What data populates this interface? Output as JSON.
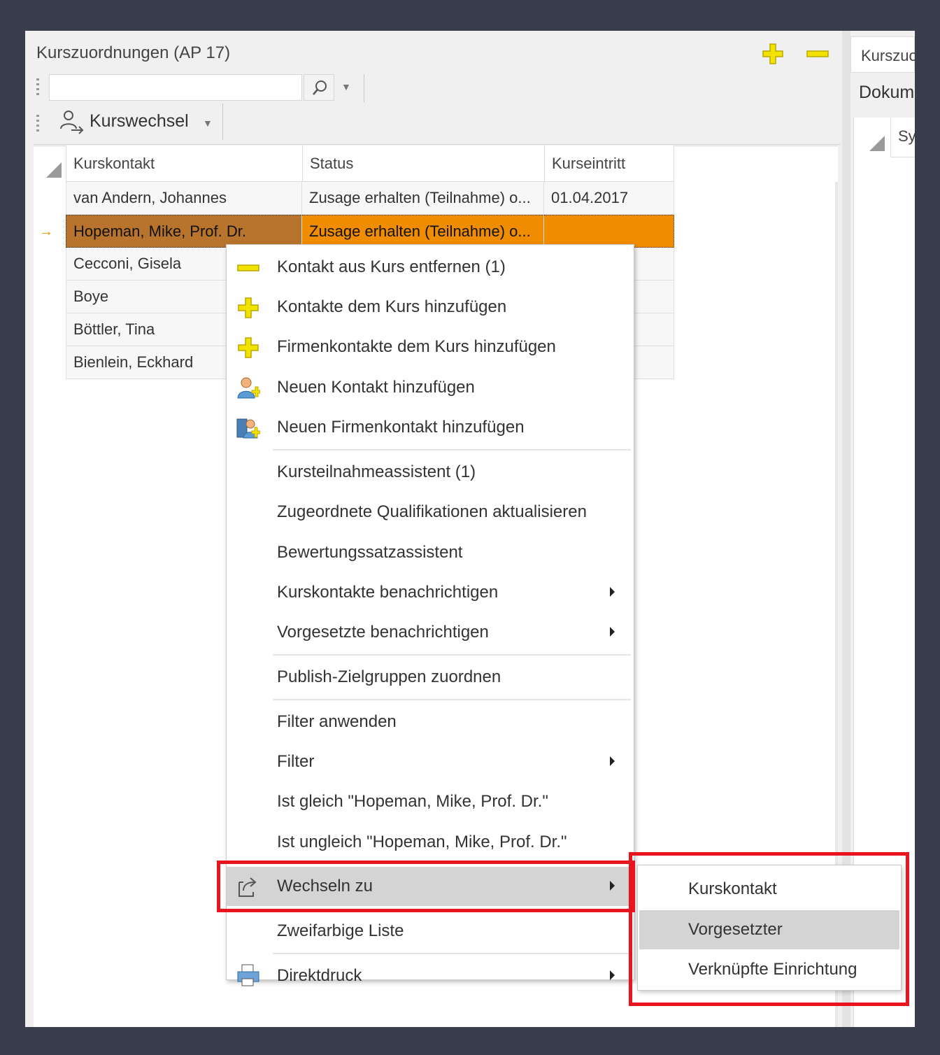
{
  "panel": {
    "title": "Kurszuordnungen (AP 17)",
    "search_value": "",
    "kurswechsel_label": "Kurswechsel"
  },
  "grid": {
    "columns": [
      "Kurskontakt",
      "Status",
      "Kurseintritt"
    ],
    "rows": [
      {
        "kontakt": "van Andern, Johannes",
        "status": "Zusage erhalten (Teilnahme) o...",
        "eintritt": "01.04.2017"
      },
      {
        "kontakt": "Hopeman, Mike, Prof. Dr.",
        "status": "Zusage erhalten (Teilnahme) o...",
        "eintritt": "",
        "selected": true
      },
      {
        "kontakt": "Cecconi, Gisela",
        "status": "",
        "eintritt": ""
      },
      {
        "kontakt": "Boye",
        "status": "",
        "eintritt": ""
      },
      {
        "kontakt": "Böttler, Tina",
        "status": "",
        "eintritt": ""
      },
      {
        "kontakt": "Bienlein, Eckhard",
        "status": "",
        "eintritt": ""
      }
    ],
    "current_row_indicator": "→"
  },
  "right_panel": {
    "tab_label": "Kurszuo",
    "section_label": "Dokum",
    "column_label": "Sy"
  },
  "context_menu": {
    "items": [
      {
        "label": "Kontakt aus Kurs entfernen (1)",
        "icon": "minus-icon"
      },
      {
        "label": "Kontakte dem Kurs hinzufügen",
        "icon": "plus-icon"
      },
      {
        "label": "Firmenkontakte dem Kurs hinzufügen",
        "icon": "plus-icon"
      },
      {
        "label": "Neuen Kontakt hinzufügen",
        "icon": "new-contact-icon"
      },
      {
        "label": "Neuen Firmenkontakt hinzufügen",
        "icon": "new-company-contact-icon"
      },
      {
        "label": "Kursteilnahmeassistent (1)"
      },
      {
        "label": "Zugeordnete Qualifikationen aktualisieren"
      },
      {
        "label": "Bewertungssatzassistent"
      },
      {
        "label": "Kurskontakte benachrichtigen",
        "submenu": true
      },
      {
        "label": "Vorgesetzte benachrichtigen",
        "submenu": true
      },
      {
        "label": "Publish-Zielgruppen zuordnen"
      },
      {
        "label": "Filter anwenden"
      },
      {
        "label": "Filter",
        "submenu": true
      },
      {
        "label": "Ist gleich \"Hopeman, Mike, Prof. Dr.\""
      },
      {
        "label": "Ist ungleich \"Hopeman, Mike, Prof. Dr.\""
      },
      {
        "label": "Wechseln zu",
        "icon": "switch-to-icon",
        "submenu": true,
        "highlighted": true
      },
      {
        "label": "Zweifarbige Liste"
      },
      {
        "label": "Direktdruck",
        "icon": "print-icon",
        "submenu": true
      }
    ]
  },
  "submenu": {
    "items": [
      {
        "label": "Kurskontakt"
      },
      {
        "label": "Vorgesetzter",
        "highlighted": true
      },
      {
        "label": "Verknüpfte Einrichtung"
      }
    ]
  },
  "colors": {
    "selection": "#f08c00",
    "selection_first_cell": "#b8742c",
    "highlight_box": "#e8141e",
    "icon_yellow": "#f2e200",
    "menu_hover": "#d4d4d4"
  }
}
